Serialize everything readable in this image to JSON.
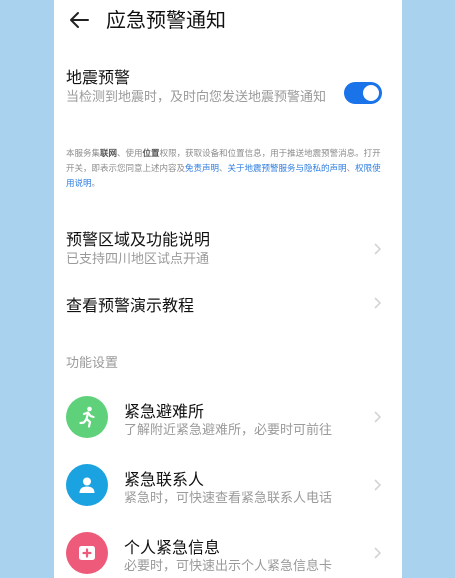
{
  "header": {
    "title": "应急预警通知"
  },
  "earthquake": {
    "title": "地震预警",
    "desc": "当检测到地震时，及时向您发送地震预警通知",
    "toggle_on": true
  },
  "notice": {
    "p1": "本服务集",
    "b1": "联网",
    "p2": "、使用",
    "b2": "位置",
    "p3": "权限，获取设备和位置信息，用于推送地震预警消息。打开开关，即表示您同意上述内容及",
    "link1": "免责声明",
    "p4": "、",
    "link2": "关于地震预警服务与隐私的声明",
    "p5": "、",
    "link3": "权限使用说明",
    "p6": "。"
  },
  "menu": {
    "region": {
      "title": "预警区域及功能说明",
      "sub": "已支持四川地区试点开通"
    },
    "tutorial": {
      "title": "查看预警演示教程"
    }
  },
  "section": {
    "label": "功能设置"
  },
  "features": [
    {
      "title": "紧急避难所",
      "sub": "了解附近紧急避难所，必要时可前往",
      "icon": "running-person-icon",
      "color": "#5fd17a"
    },
    {
      "title": "紧急联系人",
      "sub": "紧急时，可快速查看紧急联系人电话",
      "icon": "contact-person-icon",
      "color": "#1aa3e0"
    },
    {
      "title": "个人紧急信息",
      "sub": "必要时，可快速出示个人紧急信息卡",
      "icon": "medical-card-icon",
      "color": "#ee5a7a"
    }
  ],
  "colors": {
    "accent": "#1a73e8",
    "link": "#2f7de0"
  }
}
